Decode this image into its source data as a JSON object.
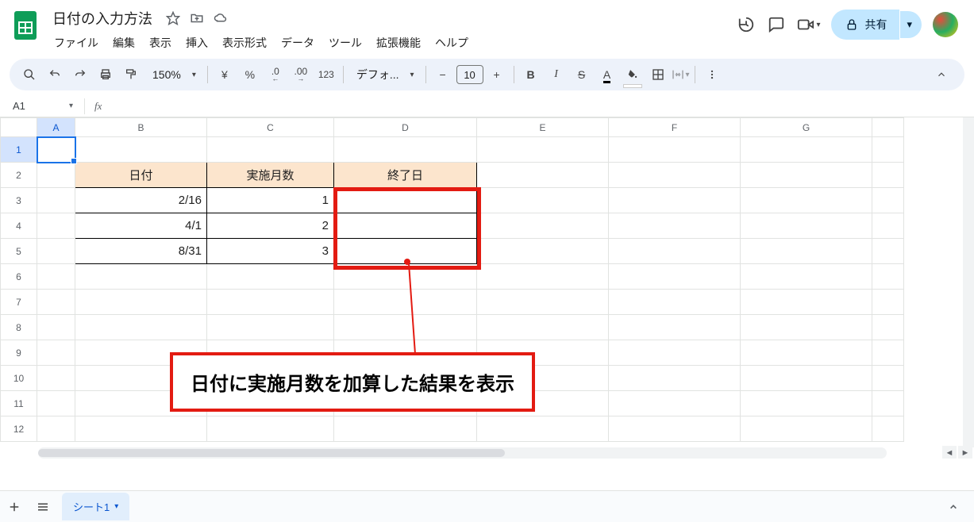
{
  "doc": {
    "title": "日付の入力方法"
  },
  "menus": [
    "ファイル",
    "編集",
    "表示",
    "挿入",
    "表示形式",
    "データ",
    "ツール",
    "拡張機能",
    "ヘルプ"
  ],
  "share": {
    "label": "共有"
  },
  "toolbar": {
    "zoom": "150%",
    "currency": "¥",
    "percent": "%",
    "dec_dec": ".0",
    "dec_inc": ".00",
    "fmt123": "123",
    "font": "デフォ...",
    "minus": "−",
    "fontsize": "10",
    "plus": "+",
    "bold": "B",
    "italic": "I",
    "strike": "S",
    "textA": "A"
  },
  "namebox": "A1",
  "fx": "fx",
  "columns": [
    "A",
    "B",
    "C",
    "D",
    "E",
    "F",
    "G"
  ],
  "rows": [
    "1",
    "2",
    "3",
    "4",
    "5",
    "6",
    "7",
    "8",
    "9",
    "10",
    "11",
    "12"
  ],
  "tbl": {
    "h1": "日付",
    "h2": "実施月数",
    "h3": "終了日",
    "r1c1": "2/16",
    "r1c2": "1",
    "r2c1": "4/1",
    "r2c2": "2",
    "r3c1": "8/31",
    "r3c2": "3"
  },
  "annotation": "日付に実施月数を加算した結果を表示",
  "sheet_tab": "シート1"
}
